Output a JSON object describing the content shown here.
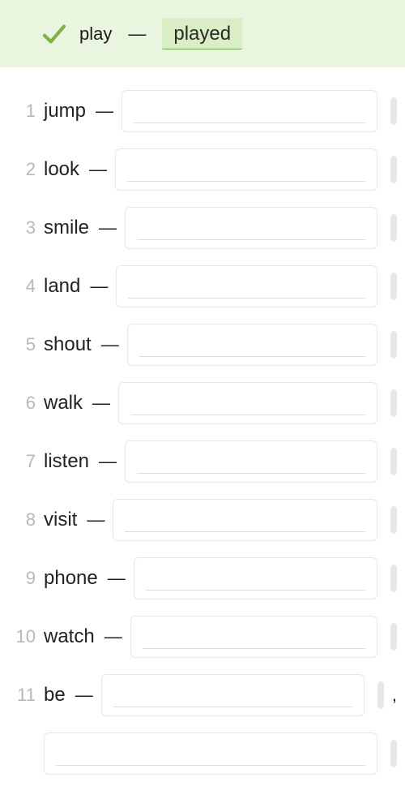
{
  "example": {
    "word": "play",
    "answer": "played"
  },
  "items": [
    {
      "n": "1",
      "word": "jump"
    },
    {
      "n": "2",
      "word": "look"
    },
    {
      "n": "3",
      "word": "smile"
    },
    {
      "n": "4",
      "word": "land"
    },
    {
      "n": "5",
      "word": "shout"
    },
    {
      "n": "6",
      "word": "walk"
    },
    {
      "n": "7",
      "word": "listen"
    },
    {
      "n": "8",
      "word": "visit"
    },
    {
      "n": "9",
      "word": "phone"
    },
    {
      "n": "10",
      "word": "watch"
    },
    {
      "n": "11",
      "word": "be",
      "trailing": ","
    }
  ],
  "dash": "—"
}
